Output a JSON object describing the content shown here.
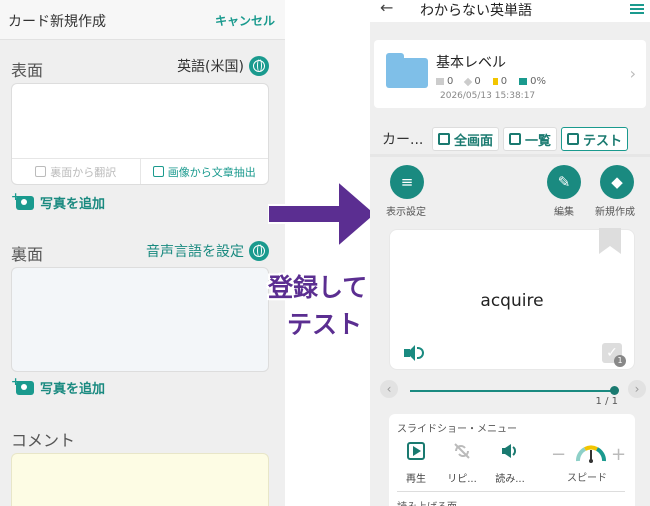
{
  "left": {
    "header": {
      "title": "カード新規作成",
      "cancel": "キャンセル"
    },
    "front": {
      "label": "表面",
      "language": "英語(米国)",
      "tool_translate": "裏面から翻訳",
      "tool_ocr": "画像から文章抽出",
      "add_photo": "写真を追加"
    },
    "back": {
      "label": "裏面",
      "set_voice": "音声言語を設定",
      "add_photo": "写真を追加"
    },
    "comment": {
      "label": "コメント"
    }
  },
  "callout": {
    "line1": "登録して",
    "line2": "テスト",
    "color": "#5b2e91"
  },
  "right": {
    "header": {
      "title": "わからない英単語"
    },
    "deck": {
      "name": "基本レベル",
      "stats": [
        "0",
        "0",
        "0",
        "0%"
      ],
      "date": "2026/05/13 15:38:17"
    },
    "tabs": {
      "current": "カー...",
      "fullscreen": "全画面",
      "list": "一覧",
      "test": "テスト"
    },
    "actions": {
      "display_settings": "表示設定",
      "edit": "編集",
      "new": "新規作成"
    },
    "card": {
      "word": "acquire",
      "badge": "1"
    },
    "slider": {
      "count": "1 / 1"
    },
    "slideshow": {
      "title": "スライドショー・メニュー",
      "play": "再生",
      "repeat": "リピ...",
      "read": "読み...",
      "speed": "スピード",
      "read_side": "読み上げる面"
    },
    "accent": "#1a8a80"
  }
}
